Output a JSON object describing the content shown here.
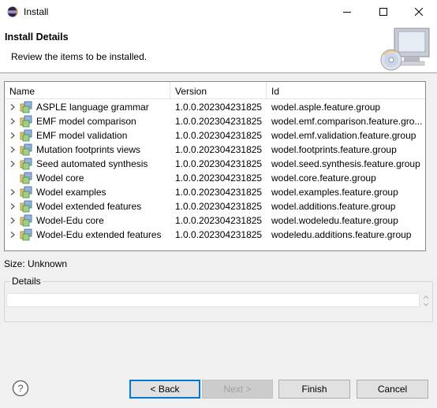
{
  "window": {
    "title": "Install",
    "icon": "eclipse-icon",
    "controls": [
      "minimize",
      "maximize",
      "close"
    ]
  },
  "header": {
    "title": "Install Details",
    "description": "Review the items to be installed."
  },
  "table": {
    "columns": [
      "Name",
      "Version",
      "Id"
    ],
    "rows": [
      {
        "name": "ASPLE language grammar",
        "version": "1.0.0.202304231825",
        "id": "wodel.asple.feature.group",
        "expandable": true
      },
      {
        "name": "EMF model comparison",
        "version": "1.0.0.202304231825",
        "id": "wodel.emf.comparison.feature.gro...",
        "expandable": true
      },
      {
        "name": "EMF model validation",
        "version": "1.0.0.202304231825",
        "id": "wodel.emf.validation.feature.group",
        "expandable": true
      },
      {
        "name": "Mutation footprints views",
        "version": "1.0.0.202304231825",
        "id": "wodel.footprints.feature.group",
        "expandable": true
      },
      {
        "name": "Seed automated synthesis",
        "version": "1.0.0.202304231825",
        "id": "wodel.seed.synthesis.feature.group",
        "expandable": true
      },
      {
        "name": "Wodel core",
        "version": "1.0.0.202304231825",
        "id": "wodel.core.feature.group",
        "expandable": false
      },
      {
        "name": "Wodel examples",
        "version": "1.0.0.202304231825",
        "id": "wodel.examples.feature.group",
        "expandable": true
      },
      {
        "name": "Wodel extended features",
        "version": "1.0.0.202304231825",
        "id": "wodel.additions.feature.group",
        "expandable": true
      },
      {
        "name": "Wodel-Edu core",
        "version": "1.0.0.202304231825",
        "id": "wodel.wodeledu.feature.group",
        "expandable": true
      },
      {
        "name": "Wodel-Edu extended features",
        "version": "1.0.0.202304231825",
        "id": "wodeledu.additions.feature.group",
        "expandable": true
      }
    ]
  },
  "size_label": "Size: Unknown",
  "details": {
    "legend": "Details",
    "text": ""
  },
  "buttons": {
    "back": "< Back",
    "next": "Next >",
    "finish": "Finish",
    "cancel": "Cancel"
  },
  "colors": {
    "accent": "#0078d7",
    "dialog_bg": "#f0f0f0"
  }
}
